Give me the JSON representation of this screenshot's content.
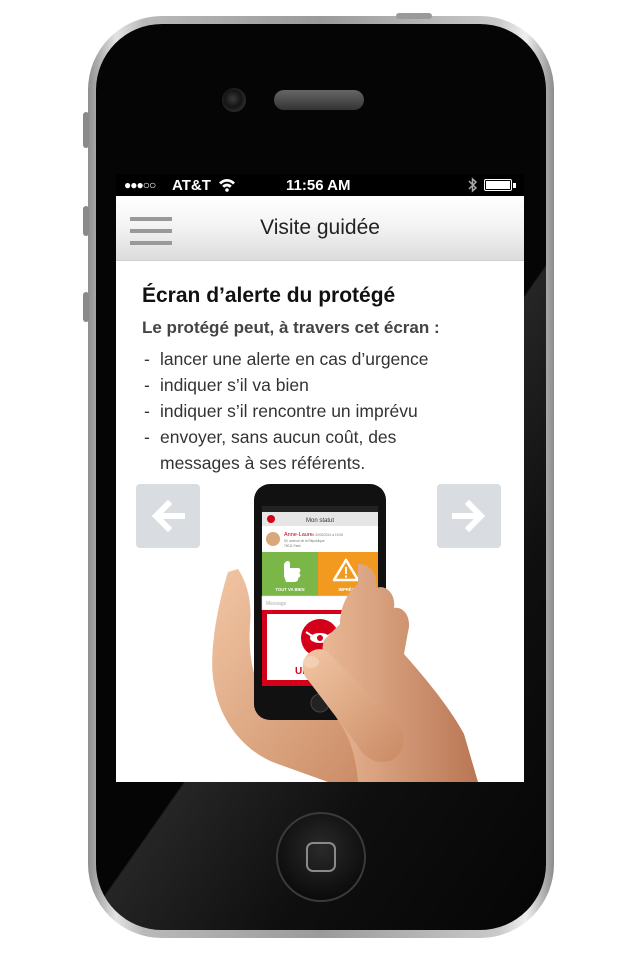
{
  "status_bar": {
    "signal": "●●●○○",
    "carrier": "AT&T",
    "time": "11:56 AM"
  },
  "nav": {
    "title": "Visite guidée",
    "menu_icon": "hamburger-menu-icon"
  },
  "content": {
    "title": "Écran d’alerte du protégé",
    "subtitle": "Le protégé peut, à travers cet écran :",
    "items": [
      "lancer une alerte en cas d’urgence",
      "indiquer s’il va bien",
      "indiquer s’il rencontre un imprévu",
      "envoyer, sans aucun coût, des"
    ],
    "items_continuation": "messages à ses référents."
  },
  "demo_screen": {
    "header": "Mon statut",
    "contact_name": "Anne-Laure",
    "contact_detail": "le 20/02/2014 à 19:08",
    "contact_address_1": "50, avenue de la République",
    "contact_address_2": "75011 Paris",
    "ok_label": "TOUT VA BIEN",
    "warn_label": "IMPRÉVU",
    "message_placeholder": "Message",
    "urgence_label": "URGENCE"
  },
  "colors": {
    "urgence_red": "#d4001a",
    "ok_green": "#7ab648",
    "warn_orange": "#f29a1f",
    "arrow_button_bg": "#d9dce0"
  }
}
